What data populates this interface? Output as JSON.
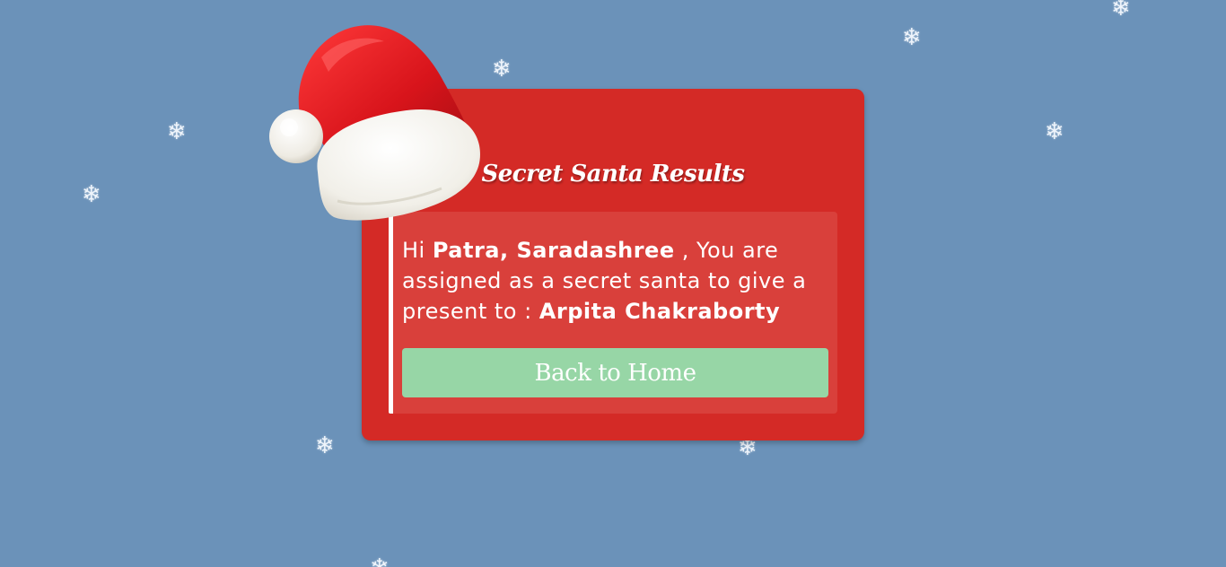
{
  "snowflakes": [
    {
      "glyph": "❄"
    },
    {
      "glyph": "❄"
    },
    {
      "glyph": "❄"
    },
    {
      "glyph": "❄"
    },
    {
      "glyph": "❄"
    },
    {
      "glyph": "❄"
    },
    {
      "glyph": "❄"
    },
    {
      "glyph": "❄"
    },
    {
      "glyph": "❄"
    }
  ],
  "card": {
    "title": "Secret Santa Results",
    "message": {
      "greeting": "Hi ",
      "giver_name": "Patra, Saradashree",
      "middle_text": " , You are assigned as a secret santa to give a present to : ",
      "receiver_name": "Arpita Chakraborty"
    },
    "back_button_label": "Back to Home"
  },
  "colors": {
    "background": "#6b92b9",
    "card": "#d42a26",
    "message_box": "#d9403b",
    "button": "#97d6a6",
    "text": "#ffffff"
  },
  "icons": {
    "hat": "santa-hat-icon",
    "snow": "snowflake-icon"
  }
}
